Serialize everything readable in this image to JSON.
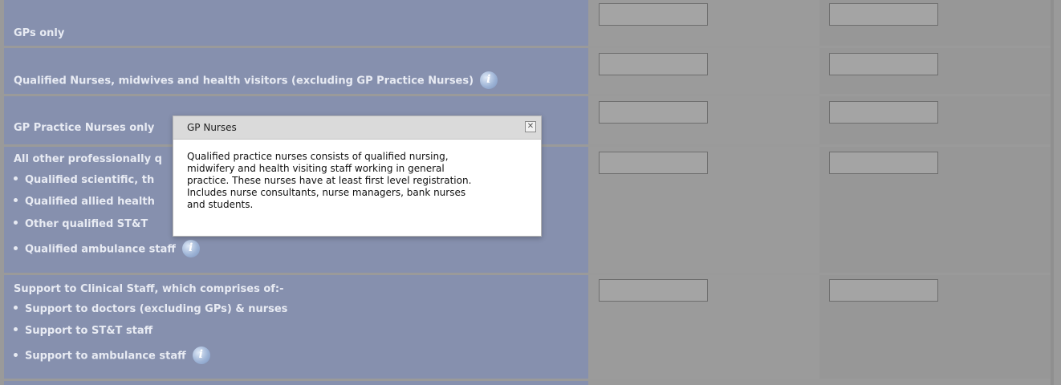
{
  "rows": {
    "gps_only": {
      "label": "GPs only"
    },
    "qualified_nurses": {
      "label": "Qualified Nurses, midwives and health visitors (excluding GP Practice Nurses)"
    },
    "gp_practice_nurses": {
      "label": "GP Practice Nurses only"
    },
    "other_professional": {
      "label": "All other professionally q",
      "items": [
        "Qualified scientific, th",
        "Qualified allied health",
        "Other qualified ST&T",
        "Qualified ambulance staff"
      ]
    },
    "support_clinical": {
      "label": "Support to Clinical Staff, which comprises of:-",
      "items": [
        "Support to doctors (excluding GPs) & nurses",
        "Support to ST&T staff",
        "Support to ambulance staff"
      ]
    }
  },
  "popup": {
    "title": "GP Nurses",
    "close_glyph": "✕",
    "body_lines": [
      "Qualified practice nurses consists of qualified nursing,",
      "midwifery and health visiting staff working in general",
      "practice. These nurses have at least first level registration.",
      "Includes nurse consultants, nurse managers, bank nurses",
      "and students."
    ]
  },
  "icons": {
    "info": "info-icon"
  },
  "colors": {
    "label_bg": "#8690ae",
    "overlay_bg": "#9a9a9a",
    "popup_header": "#dadada"
  }
}
